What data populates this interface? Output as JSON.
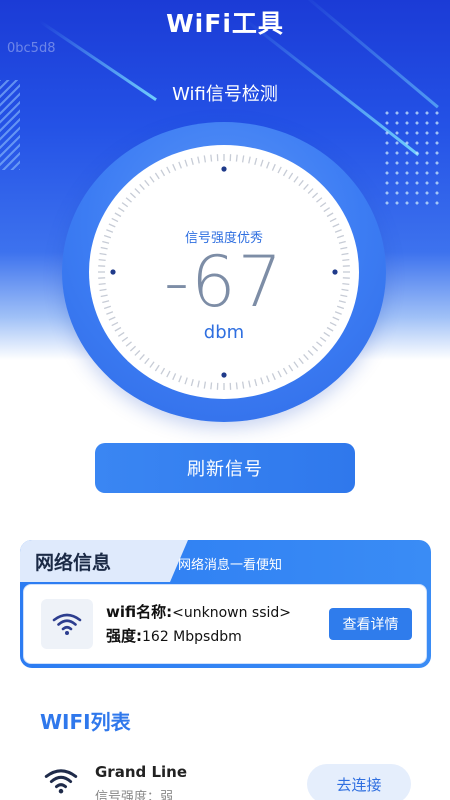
{
  "app": {
    "title": "WiFi工具",
    "hex_tag": "0bc5d8"
  },
  "gauge": {
    "section_title": "Wifi信号检测",
    "status": "信号强度优秀",
    "value": "-67",
    "unit": "dbm"
  },
  "actions": {
    "refresh_label": "刷新信号"
  },
  "network_info": {
    "tab_label": "网络信息",
    "subtitle": "网络消息一看便知",
    "name_label": "wifi名称:",
    "name_value": "<unknown ssid>",
    "strength_label": "强度:",
    "strength_value": "162 Mbpsdbm",
    "detail_label": "查看详情"
  },
  "wifi_list": {
    "title": "WIFI列表",
    "items": [
      {
        "name": "Grand Line",
        "strength_text": "信号强度：弱",
        "connect_label": "去连接"
      }
    ]
  },
  "colors": {
    "accent": "#2f78ec",
    "hero": "#1b3bd6"
  },
  "icons": [
    "wifi-icon"
  ]
}
